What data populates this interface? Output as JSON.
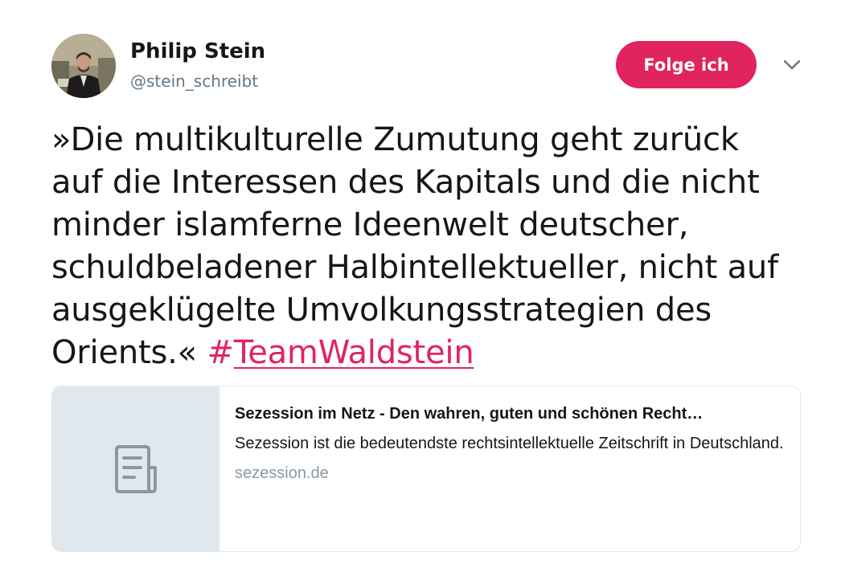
{
  "author": {
    "display_name": "Philip Stein",
    "handle": "@stein_schreibt"
  },
  "follow_button": {
    "label": "Folge ich",
    "color": "#e0245e"
  },
  "menu": {
    "icon": "chevron-down-icon"
  },
  "tweet": {
    "lines": [
      "»Die multikulturelle Zumutung geht zurück",
      "auf die Interessen des Kapitals und die nicht",
      "minder islamferne Ideenwelt deutscher,",
      "schuldbeladener Halbintellektueller, nicht auf",
      "ausgeklügelte Umvolkungsstrategien des",
      "Orients.«"
    ],
    "hashtag_symbol": "#",
    "hashtag_word": "TeamWaldstein",
    "hashtag_color": "#e0245e"
  },
  "link_card": {
    "thumbnail_icon": "document-icon",
    "title": "Sezession im Netz - Den wahren, guten und schönen Recht…",
    "description": "Sezession ist die bedeutendste rechtsintellektuelle Zeitschrift in Deutschland.",
    "domain": "sezession.de"
  }
}
